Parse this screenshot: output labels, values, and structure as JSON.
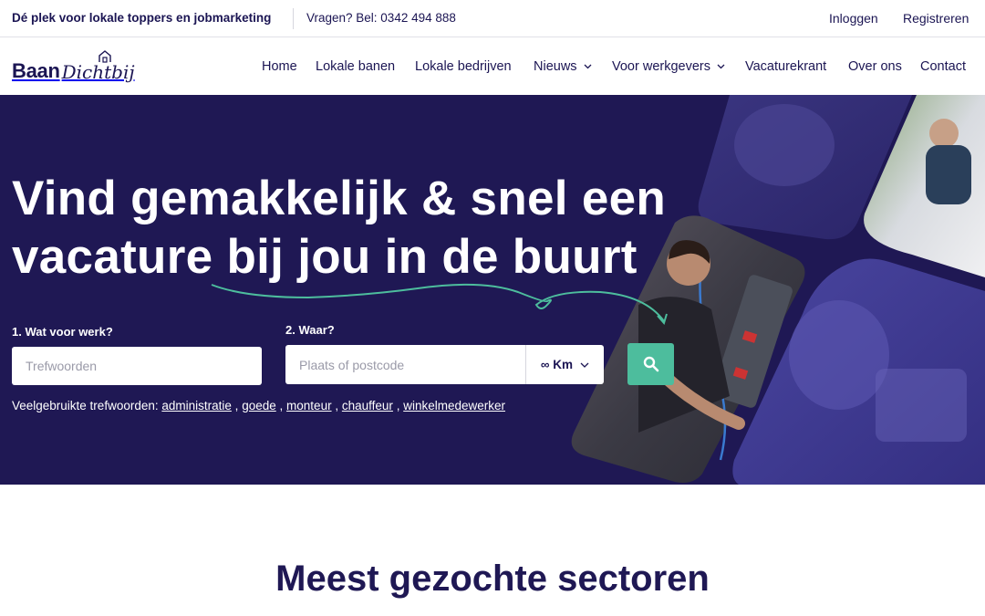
{
  "topbar": {
    "tagline": "Dé plek voor lokale toppers en jobmarketing",
    "phone": "Vragen? Bel: 0342 494 888",
    "login": "Inloggen",
    "register": "Registreren"
  },
  "logo": {
    "part1": "Baan",
    "part2": "Dichtbij"
  },
  "nav": {
    "items": [
      {
        "label": "Home"
      },
      {
        "label": "Lokale banen"
      },
      {
        "label": "Lokale bedrijven"
      },
      {
        "label": "Nieuws"
      },
      {
        "label": "Voor werkgevers"
      },
      {
        "label": "Vacaturekrant"
      },
      {
        "label": "Over ons"
      },
      {
        "label": "Contact"
      }
    ]
  },
  "hero": {
    "line1": "Vind gemakkelijk & snel een",
    "line2": "vacature bij jou in de buurt",
    "what_label": "1. Wat voor werk?",
    "what_placeholder": "Trefwoorden",
    "where_label": "2. Waar?",
    "where_placeholder": "Plaats of postcode",
    "distance": "∞ Km",
    "popular_label": "Veelgebruikte trefwoorden:",
    "keywords": [
      "administratie",
      "goede",
      "monteur",
      "chauffeur",
      "winkelmedewerker"
    ],
    "separator": ","
  },
  "sectors": {
    "title": "Meest gezochte sectoren"
  },
  "colors": {
    "navy": "#1f1854",
    "text": "#1b1553",
    "accent": "#4dbd9d"
  },
  "icons": {
    "search": "search-icon",
    "chevron": "chevron-down-icon",
    "logo_house": "house-icon"
  }
}
